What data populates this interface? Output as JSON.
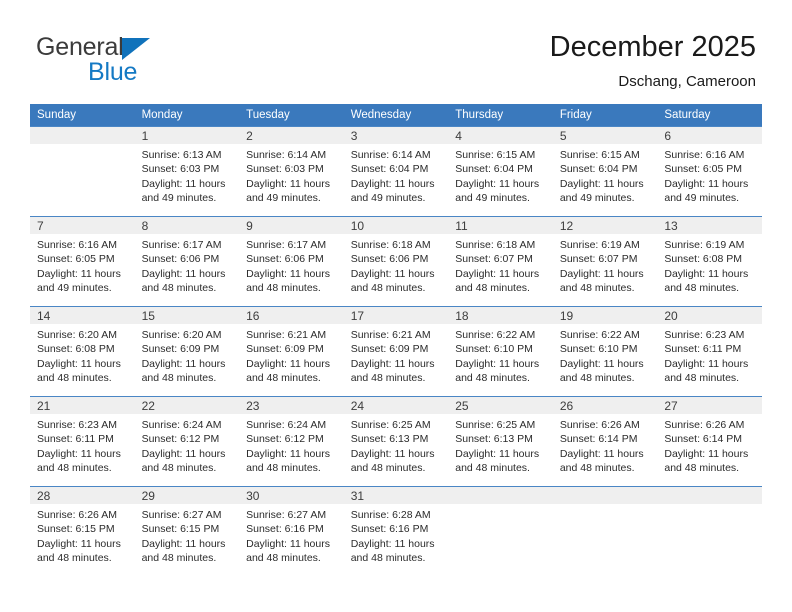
{
  "brand": {
    "name_part1": "General",
    "name_part2": "Blue",
    "accent_color": "#1479c4",
    "triangle_color": "#1072bb"
  },
  "header": {
    "title": "December 2025",
    "subtitle": "Dschang, Cameroon"
  },
  "calendar": {
    "header_bg": "#3a79bd",
    "header_text_color": "#ffffff",
    "daynum_strip_bg": "#efefef",
    "weekday_headers": [
      "Sunday",
      "Monday",
      "Tuesday",
      "Wednesday",
      "Thursday",
      "Friday",
      "Saturday"
    ],
    "weeks": [
      [
        {
          "day": "",
          "lines": []
        },
        {
          "day": "1",
          "lines": [
            "Sunrise: 6:13 AM",
            "Sunset: 6:03 PM",
            "Daylight: 11 hours",
            "and 49 minutes."
          ]
        },
        {
          "day": "2",
          "lines": [
            "Sunrise: 6:14 AM",
            "Sunset: 6:03 PM",
            "Daylight: 11 hours",
            "and 49 minutes."
          ]
        },
        {
          "day": "3",
          "lines": [
            "Sunrise: 6:14 AM",
            "Sunset: 6:04 PM",
            "Daylight: 11 hours",
            "and 49 minutes."
          ]
        },
        {
          "day": "4",
          "lines": [
            "Sunrise: 6:15 AM",
            "Sunset: 6:04 PM",
            "Daylight: 11 hours",
            "and 49 minutes."
          ]
        },
        {
          "day": "5",
          "lines": [
            "Sunrise: 6:15 AM",
            "Sunset: 6:04 PM",
            "Daylight: 11 hours",
            "and 49 minutes."
          ]
        },
        {
          "day": "6",
          "lines": [
            "Sunrise: 6:16 AM",
            "Sunset: 6:05 PM",
            "Daylight: 11 hours",
            "and 49 minutes."
          ]
        }
      ],
      [
        {
          "day": "7",
          "lines": [
            "Sunrise: 6:16 AM",
            "Sunset: 6:05 PM",
            "Daylight: 11 hours",
            "and 49 minutes."
          ]
        },
        {
          "day": "8",
          "lines": [
            "Sunrise: 6:17 AM",
            "Sunset: 6:06 PM",
            "Daylight: 11 hours",
            "and 48 minutes."
          ]
        },
        {
          "day": "9",
          "lines": [
            "Sunrise: 6:17 AM",
            "Sunset: 6:06 PM",
            "Daylight: 11 hours",
            "and 48 minutes."
          ]
        },
        {
          "day": "10",
          "lines": [
            "Sunrise: 6:18 AM",
            "Sunset: 6:06 PM",
            "Daylight: 11 hours",
            "and 48 minutes."
          ]
        },
        {
          "day": "11",
          "lines": [
            "Sunrise: 6:18 AM",
            "Sunset: 6:07 PM",
            "Daylight: 11 hours",
            "and 48 minutes."
          ]
        },
        {
          "day": "12",
          "lines": [
            "Sunrise: 6:19 AM",
            "Sunset: 6:07 PM",
            "Daylight: 11 hours",
            "and 48 minutes."
          ]
        },
        {
          "day": "13",
          "lines": [
            "Sunrise: 6:19 AM",
            "Sunset: 6:08 PM",
            "Daylight: 11 hours",
            "and 48 minutes."
          ]
        }
      ],
      [
        {
          "day": "14",
          "lines": [
            "Sunrise: 6:20 AM",
            "Sunset: 6:08 PM",
            "Daylight: 11 hours",
            "and 48 minutes."
          ]
        },
        {
          "day": "15",
          "lines": [
            "Sunrise: 6:20 AM",
            "Sunset: 6:09 PM",
            "Daylight: 11 hours",
            "and 48 minutes."
          ]
        },
        {
          "day": "16",
          "lines": [
            "Sunrise: 6:21 AM",
            "Sunset: 6:09 PM",
            "Daylight: 11 hours",
            "and 48 minutes."
          ]
        },
        {
          "day": "17",
          "lines": [
            "Sunrise: 6:21 AM",
            "Sunset: 6:09 PM",
            "Daylight: 11 hours",
            "and 48 minutes."
          ]
        },
        {
          "day": "18",
          "lines": [
            "Sunrise: 6:22 AM",
            "Sunset: 6:10 PM",
            "Daylight: 11 hours",
            "and 48 minutes."
          ]
        },
        {
          "day": "19",
          "lines": [
            "Sunrise: 6:22 AM",
            "Sunset: 6:10 PM",
            "Daylight: 11 hours",
            "and 48 minutes."
          ]
        },
        {
          "day": "20",
          "lines": [
            "Sunrise: 6:23 AM",
            "Sunset: 6:11 PM",
            "Daylight: 11 hours",
            "and 48 minutes."
          ]
        }
      ],
      [
        {
          "day": "21",
          "lines": [
            "Sunrise: 6:23 AM",
            "Sunset: 6:11 PM",
            "Daylight: 11 hours",
            "and 48 minutes."
          ]
        },
        {
          "day": "22",
          "lines": [
            "Sunrise: 6:24 AM",
            "Sunset: 6:12 PM",
            "Daylight: 11 hours",
            "and 48 minutes."
          ]
        },
        {
          "day": "23",
          "lines": [
            "Sunrise: 6:24 AM",
            "Sunset: 6:12 PM",
            "Daylight: 11 hours",
            "and 48 minutes."
          ]
        },
        {
          "day": "24",
          "lines": [
            "Sunrise: 6:25 AM",
            "Sunset: 6:13 PM",
            "Daylight: 11 hours",
            "and 48 minutes."
          ]
        },
        {
          "day": "25",
          "lines": [
            "Sunrise: 6:25 AM",
            "Sunset: 6:13 PM",
            "Daylight: 11 hours",
            "and 48 minutes."
          ]
        },
        {
          "day": "26",
          "lines": [
            "Sunrise: 6:26 AM",
            "Sunset: 6:14 PM",
            "Daylight: 11 hours",
            "and 48 minutes."
          ]
        },
        {
          "day": "27",
          "lines": [
            "Sunrise: 6:26 AM",
            "Sunset: 6:14 PM",
            "Daylight: 11 hours",
            "and 48 minutes."
          ]
        }
      ],
      [
        {
          "day": "28",
          "lines": [
            "Sunrise: 6:26 AM",
            "Sunset: 6:15 PM",
            "Daylight: 11 hours",
            "and 48 minutes."
          ]
        },
        {
          "day": "29",
          "lines": [
            "Sunrise: 6:27 AM",
            "Sunset: 6:15 PM",
            "Daylight: 11 hours",
            "and 48 minutes."
          ]
        },
        {
          "day": "30",
          "lines": [
            "Sunrise: 6:27 AM",
            "Sunset: 6:16 PM",
            "Daylight: 11 hours",
            "and 48 minutes."
          ]
        },
        {
          "day": "31",
          "lines": [
            "Sunrise: 6:28 AM",
            "Sunset: 6:16 PM",
            "Daylight: 11 hours",
            "and 48 minutes."
          ]
        },
        {
          "day": "",
          "lines": []
        },
        {
          "day": "",
          "lines": []
        },
        {
          "day": "",
          "lines": []
        }
      ]
    ]
  }
}
